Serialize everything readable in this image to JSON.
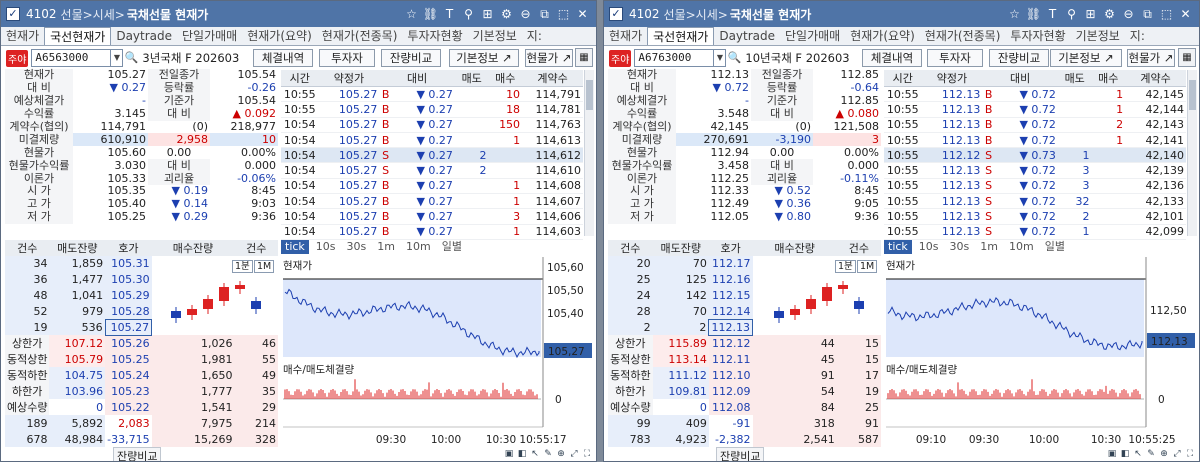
{
  "windows": [
    {
      "code": "4102",
      "path": "선물>시세>",
      "name": "국채선물 현재가",
      "tabs": [
        "현재가",
        "국선현재가",
        "Daytrade",
        "단일가매매",
        "현재가(요약)",
        "현재가(전종목)",
        "투자자현황",
        "기본정보",
        "지:"
      ],
      "active_tab": 1,
      "badge": "주야",
      "product_code": "A6563000",
      "product_name": "3년국채 F 202603",
      "buttons": [
        "체결내역",
        "투자자",
        "잔량비교",
        "기본정보 ↗",
        "현물가 ↗"
      ],
      "quote": [
        [
          "현재가",
          "105.27",
          "",
          "전일종가",
          "105.54",
          ""
        ],
        [
          "대 비",
          "▼ 0.27",
          "",
          "등락률",
          "-0.26",
          ""
        ],
        [
          "예상체결가",
          "-",
          "",
          "기준가",
          "105.54",
          ""
        ],
        [
          "수익률",
          "3.145",
          "",
          "대 비",
          "▲ 0.092",
          ""
        ],
        [
          "계약수(협의)",
          "114,791",
          "(0)",
          "218,977",
          "",
          ""
        ],
        [
          "미결제량",
          "610,910",
          "2,958",
          "10",
          "",
          ""
        ],
        [
          "현물가",
          "105.60",
          "0.00",
          "0.00%",
          "",
          ""
        ],
        [
          "현물가수익률",
          "3.030",
          "대 비",
          "0.000",
          "",
          ""
        ],
        [
          "이론가",
          "105.33",
          "괴리율",
          "-0.06%",
          "",
          ""
        ],
        [
          "시 가",
          "105.35",
          "▼ 0.19",
          "8:45",
          "",
          ""
        ],
        [
          "고 가",
          "105.40",
          "▼ 0.14",
          "9:03",
          "",
          ""
        ],
        [
          "저 가",
          "105.25",
          "▼ 0.29",
          "9:36",
          "",
          ""
        ]
      ],
      "trade_headers": [
        "시간",
        "약정가",
        "대비",
        "매도",
        "매수",
        "계약수"
      ],
      "trades": [
        [
          "10:55",
          "105.27",
          "B",
          "0.27",
          "",
          "10",
          "114,791"
        ],
        [
          "10:55",
          "105.27",
          "B",
          "0.27",
          "",
          "18",
          "114,781"
        ],
        [
          "10:54",
          "105.27",
          "B",
          "0.27",
          "",
          "150",
          "114,763"
        ],
        [
          "10:54",
          "105.27",
          "B",
          "0.27",
          "",
          "1",
          "114,613"
        ],
        [
          "10:54",
          "105.27",
          "S",
          "0.27",
          "2",
          "",
          "114,612"
        ],
        [
          "10:54",
          "105.27",
          "S",
          "0.27",
          "2",
          "",
          "114,610"
        ],
        [
          "10:54",
          "105.27",
          "B",
          "0.27",
          "",
          "1",
          "114,608"
        ],
        [
          "10:54",
          "105.27",
          "B",
          "0.27",
          "",
          "1",
          "114,607"
        ],
        [
          "10:54",
          "105.27",
          "B",
          "0.27",
          "",
          "3",
          "114,606"
        ],
        [
          "10:54",
          "105.27",
          "B",
          "0.27",
          "",
          "1",
          "114,603"
        ]
      ],
      "ob_headers": [
        "건수",
        "매도잔량",
        "호가",
        "매수잔량",
        "건수"
      ],
      "asks": [
        [
          "34",
          "1,859",
          "105.31"
        ],
        [
          "36",
          "1,477",
          "105.30"
        ],
        [
          "48",
          "1,041",
          "105.29"
        ],
        [
          "52",
          "979",
          "105.28"
        ],
        [
          "19",
          "536",
          "105.27"
        ]
      ],
      "bids": [
        [
          "105.26",
          "1,026",
          "46"
        ],
        [
          "105.25",
          "1,981",
          "55"
        ],
        [
          "105.24",
          "1,650",
          "49"
        ],
        [
          "105.23",
          "1,777",
          "35"
        ],
        [
          "105.22",
          "1,541",
          "29"
        ]
      ],
      "limits": [
        [
          "상한가",
          "107.12"
        ],
        [
          "동적상한",
          "105.79"
        ],
        [
          "동적하한",
          "104.75"
        ],
        [
          "하한가",
          "103.96"
        ],
        [
          "예상수량",
          "0"
        ]
      ],
      "totals": [
        [
          "189",
          "5,892",
          "2,083",
          "7,975",
          "214"
        ],
        [
          "678",
          "48,984",
          "-33,715",
          "15,269",
          "328"
        ]
      ],
      "bottom_label": "잔량비교",
      "chart_tabs": [
        "tick",
        "10s",
        "30s",
        "1m",
        "10m",
        "일별"
      ],
      "pill1": "1분",
      "pill2": "1M",
      "chart_title": "현재가",
      "vol_title": "매수/매도체결량",
      "yticks": [
        "105,60",
        "105,50",
        "105,40",
        "105,27"
      ],
      "xticks": [
        "09:30",
        "10:00",
        "10:30",
        "10:55:17"
      ],
      "vol_zero": "0"
    },
    {
      "code": "4102",
      "path": "선물>시세>",
      "name": "국채선물 현재가",
      "tabs": [
        "현재가",
        "국선현재가",
        "Daytrade",
        "단일가매매",
        "현재가(요약)",
        "현재가(전종목)",
        "투자자현황",
        "기본정보",
        "지:"
      ],
      "active_tab": 1,
      "badge": "주야",
      "product_code": "A6763000",
      "product_name": "10년국채 F 202603",
      "buttons": [
        "체결내역",
        "투자자",
        "잔량비교",
        "기본정보 ↗",
        "현물가 ↗"
      ],
      "quote": [
        [
          "현재가",
          "112.13",
          "",
          "전일종가",
          "112.85",
          ""
        ],
        [
          "대 비",
          "▼ 0.72",
          "",
          "등락률",
          "-0.64",
          ""
        ],
        [
          "예상체결가",
          "-",
          "",
          "기준가",
          "112.85",
          ""
        ],
        [
          "수익률",
          "3.548",
          "",
          "대 비",
          "▲ 0.080",
          ""
        ],
        [
          "계약수(협의)",
          "42,145",
          "(0)",
          "121,508",
          "",
          ""
        ],
        [
          "미결제량",
          "270,691",
          "-3,190",
          "3",
          "",
          ""
        ],
        [
          "현물가",
          "112.94",
          "0.00",
          "0.00%",
          "",
          ""
        ],
        [
          "현물가수익률",
          "3.458",
          "대 비",
          "0.000",
          "",
          ""
        ],
        [
          "이론가",
          "112.25",
          "괴리율",
          "-0.11%",
          "",
          ""
        ],
        [
          "시 가",
          "112.33",
          "▼ 0.52",
          "8:45",
          "",
          ""
        ],
        [
          "고 가",
          "112.49",
          "▼ 0.36",
          "9:05",
          "",
          ""
        ],
        [
          "저 가",
          "112.05",
          "▼ 0.80",
          "9:36",
          "",
          ""
        ]
      ],
      "trade_headers": [
        "시간",
        "약정가",
        "대비",
        "매도",
        "매수",
        "계약수"
      ],
      "trades": [
        [
          "10:55",
          "112.13",
          "B",
          "0.72",
          "",
          "1",
          "42,145"
        ],
        [
          "10:55",
          "112.13",
          "B",
          "0.72",
          "",
          "1",
          "42,144"
        ],
        [
          "10:55",
          "112.13",
          "B",
          "0.72",
          "",
          "2",
          "42,143"
        ],
        [
          "10:55",
          "112.13",
          "B",
          "0.72",
          "",
          "1",
          "42,141"
        ],
        [
          "10:55",
          "112.12",
          "S",
          "0.73",
          "1",
          "",
          "42,140"
        ],
        [
          "10:55",
          "112.13",
          "S",
          "0.72",
          "3",
          "",
          "42,139"
        ],
        [
          "10:55",
          "112.13",
          "S",
          "0.72",
          "3",
          "",
          "42,136"
        ],
        [
          "10:55",
          "112.13",
          "S",
          "0.72",
          "32",
          "",
          "42,133"
        ],
        [
          "10:55",
          "112.13",
          "S",
          "0.72",
          "2",
          "",
          "42,101"
        ],
        [
          "10:55",
          "112.13",
          "S",
          "0.72",
          "1",
          "",
          "42,099"
        ]
      ],
      "ob_headers": [
        "건수",
        "매도잔량",
        "호가",
        "매수잔량",
        "건수"
      ],
      "asks": [
        [
          "20",
          "70",
          "112.17"
        ],
        [
          "25",
          "125",
          "112.16"
        ],
        [
          "24",
          "142",
          "112.15"
        ],
        [
          "28",
          "70",
          "112.14"
        ],
        [
          "2",
          "2",
          "112.13"
        ]
      ],
      "bids": [
        [
          "112.12",
          "44",
          "15"
        ],
        [
          "112.11",
          "45",
          "15"
        ],
        [
          "112.10",
          "91",
          "17"
        ],
        [
          "112.09",
          "54",
          "19"
        ],
        [
          "112.08",
          "84",
          "25"
        ]
      ],
      "limits": [
        [
          "상한가",
          "115.89"
        ],
        [
          "동적상한",
          "113.14"
        ],
        [
          "동적하한",
          "111.12"
        ],
        [
          "하한가",
          "109.81"
        ],
        [
          "예상수량",
          "0"
        ]
      ],
      "totals": [
        [
          "99",
          "409",
          "-91",
          "318",
          "91"
        ],
        [
          "783",
          "4,923",
          "-2,382",
          "2,541",
          "587"
        ]
      ],
      "bottom_label": "잔량비교",
      "chart_tabs": [
        "tick",
        "10s",
        "30s",
        "1m",
        "10m",
        "일별"
      ],
      "pill1": "1분",
      "pill2": "1M",
      "chart_title": "현재가",
      "vol_title": "매수/매도체결량",
      "yticks": [
        "112,50",
        "112,13"
      ],
      "xticks": [
        "09:10",
        "09:30",
        "10:00",
        "10:30",
        "10:55:25"
      ],
      "vol_zero": "0"
    }
  ]
}
